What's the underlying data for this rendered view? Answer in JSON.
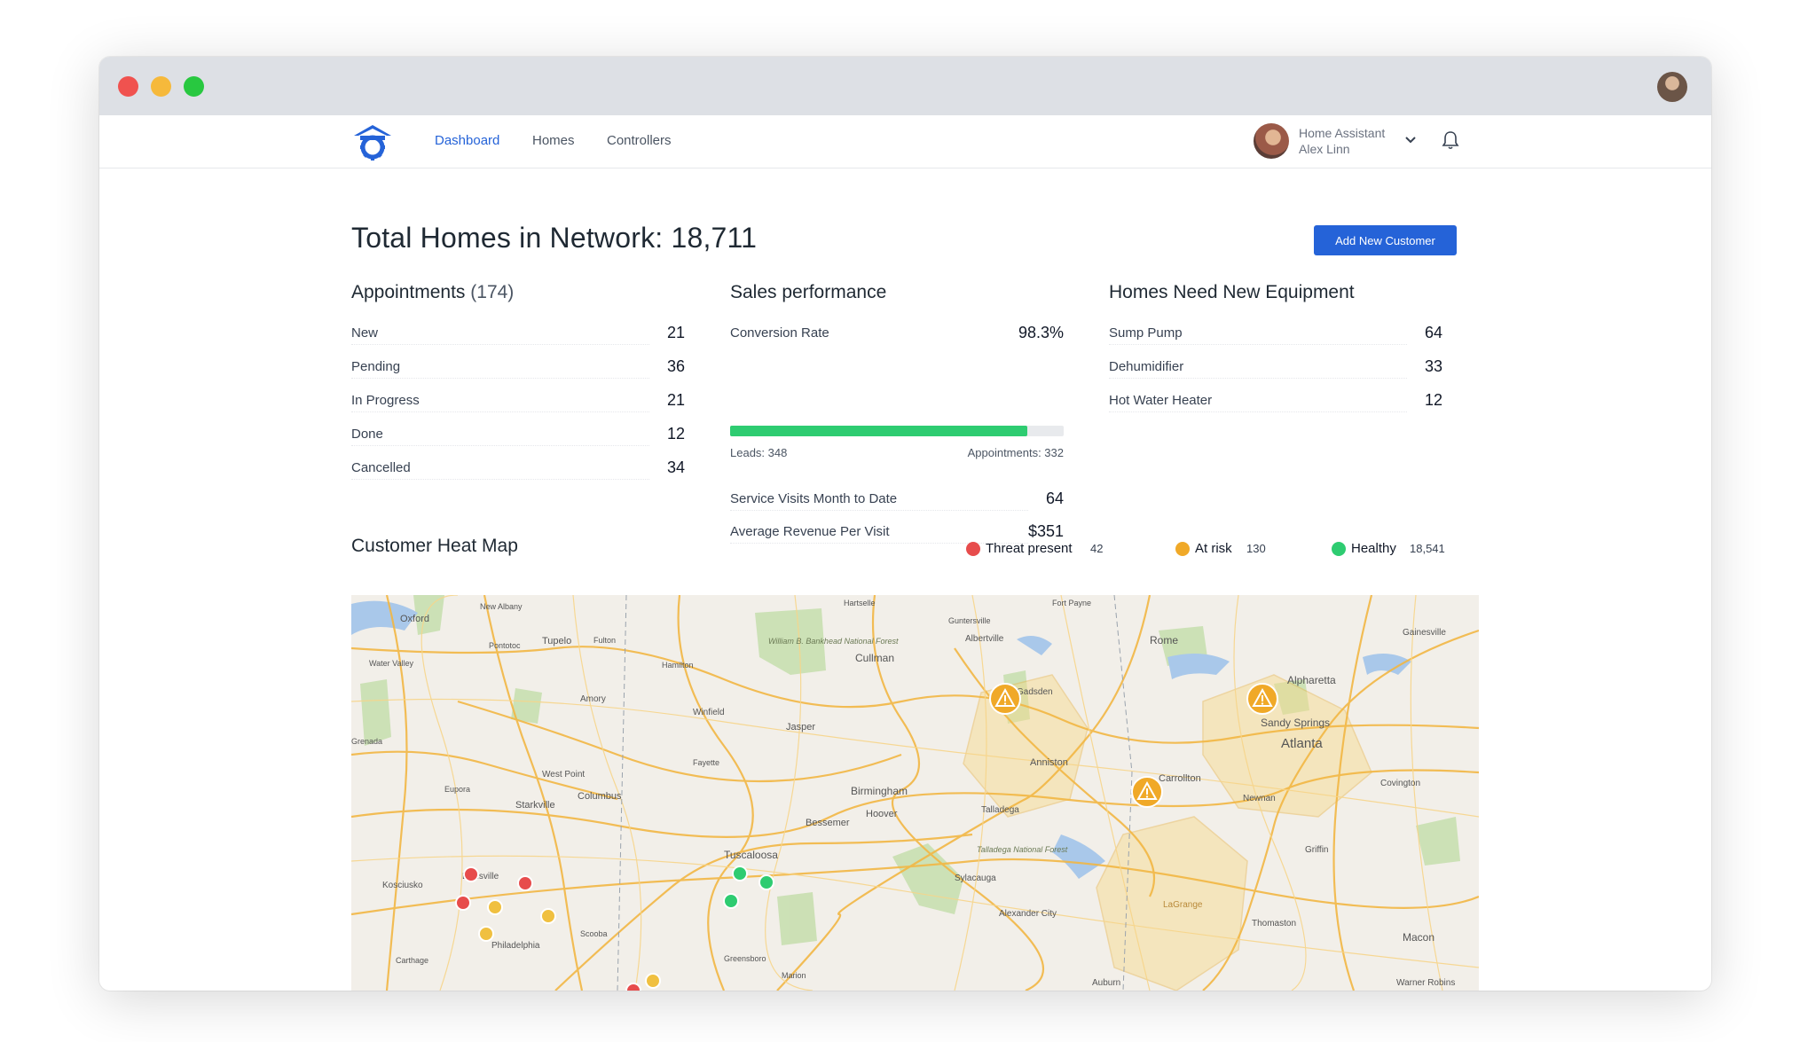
{
  "header": {
    "nav": [
      {
        "label": "Dashboard"
      },
      {
        "label": "Homes"
      },
      {
        "label": "Controllers"
      }
    ],
    "user": {
      "role": "Home Assistant",
      "name": "Alex Linn"
    }
  },
  "page": {
    "title": "Total Homes in Network: 18,711",
    "add_button_label": "Add New Customer"
  },
  "appointments": {
    "title": "Appointments",
    "count": "(174)",
    "rows": [
      {
        "label": "New",
        "value": "21"
      },
      {
        "label": "Pending",
        "value": "36"
      },
      {
        "label": "In Progress",
        "value": "21"
      },
      {
        "label": "Done",
        "value": "12"
      },
      {
        "label": "Cancelled",
        "value": "34"
      }
    ]
  },
  "sales": {
    "title": "Sales performance",
    "conversion_label": "Conversion Rate",
    "conversion_value": "98.3%",
    "progress_fraction": 0.89,
    "leads_label": "Leads: 348",
    "appointments_label": "Appointments: 332",
    "rows": [
      {
        "label": "Service Visits Month to Date",
        "value": "64"
      },
      {
        "label": "Average Revenue Per Visit",
        "value": "$351"
      }
    ]
  },
  "equipment": {
    "title": "Homes Need New Equipment",
    "rows": [
      {
        "label": "Sump Pump",
        "value": "64"
      },
      {
        "label": "Dehumidifier",
        "value": "33"
      },
      {
        "label": "Hot Water Heater",
        "value": "12"
      }
    ]
  },
  "heatmap": {
    "title": "Customer Heat Map",
    "legend": [
      {
        "label": "Threat present",
        "value": "42",
        "color": "#e74c4c"
      },
      {
        "label": "At risk",
        "value": "130",
        "color": "#f0a928"
      },
      {
        "label": "Healthy",
        "value": "18,541",
        "color": "#2ecc71"
      }
    ],
    "places": [
      "Oxford",
      "New Albany",
      "Hartselle",
      "Fort Payne",
      "Guntersville",
      "Albertville",
      "Rome",
      "Gainesville",
      "Pontotoc",
      "Tupelo",
      "Fulton",
      "Cullman",
      "Water Valley",
      "Hamilton",
      "Alpharetta",
      "Amory",
      "Winfield",
      "Jasper",
      "Sandy Springs",
      "Grenada",
      "Fayette",
      "Anniston",
      "Atlanta",
      "West Point",
      "Eupora",
      "Starkville",
      "Columbus",
      "Birmingham",
      "Bessemer",
      "Hoover",
      "Talladega",
      "Carrollton",
      "Covington",
      "Newnan",
      "Tuscaloosa",
      "Louisville",
      "Kosciusko",
      "Sylacauga",
      "Griffin",
      "Philadelphia",
      "Scooba",
      "Alexander City",
      "Thomaston",
      "LaGrange",
      "Macon",
      "Carthage",
      "Greensboro",
      "Marion",
      "Auburn",
      "Warner Robins",
      "Gadsden",
      "William B. Bankhead National Forest",
      "Talladega National Forest"
    ]
  },
  "colors": {
    "accent": "#2563d8",
    "threat": "#e74c4c",
    "risk": "#f0a928",
    "healthy": "#2ecc71"
  }
}
